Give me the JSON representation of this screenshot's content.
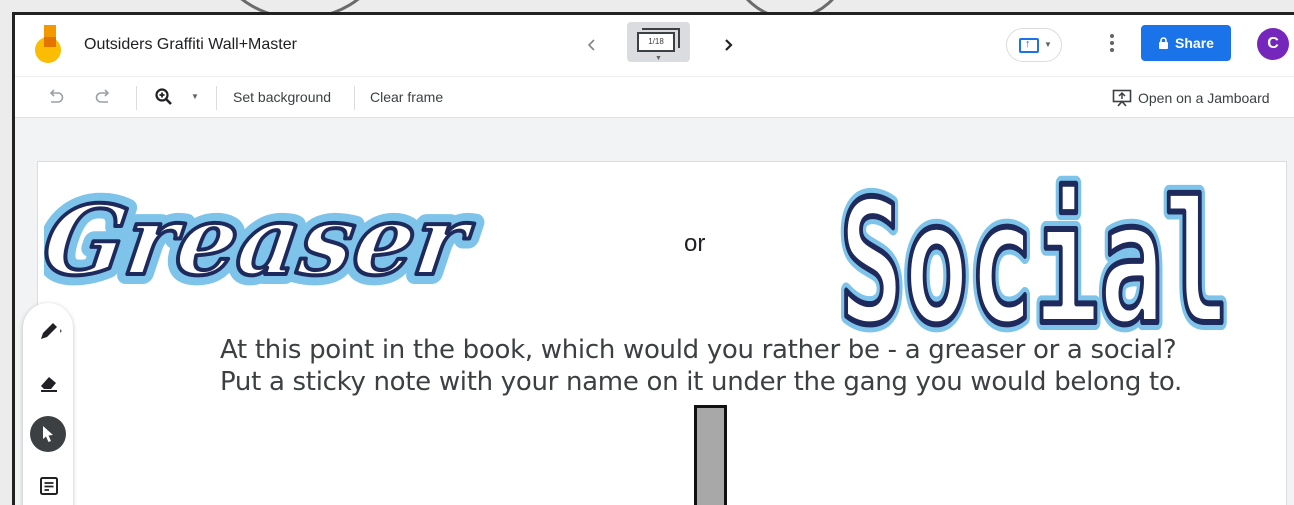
{
  "app": {
    "title": "Outsiders Graffiti Wall+Master",
    "frame_indicator": "1/18",
    "share_label": "Share",
    "avatar_initial": "C"
  },
  "toolbar": {
    "set_background_label": "Set background",
    "clear_frame_label": "Clear frame",
    "open_on_jamboard_label": "Open on a Jamboard"
  },
  "canvas": {
    "greaser_word": "Greaser",
    "or_text": "or",
    "social_word": "Social",
    "prompt_line_1": "At this point in the book, which would you rather be - a greaser or a social?",
    "prompt_line_2": "Put a sticky note with your name on it under the gang you would belong to."
  },
  "colors": {
    "accent": "#1a73e8",
    "avatar": "#7627bb",
    "graffiti_outline": "#1f2a5c",
    "graffiti_glow": "#7ec4ea"
  },
  "icons": {
    "undo": "undo-icon",
    "redo": "redo-icon",
    "zoom": "zoom-in-icon",
    "pen": "pen-icon",
    "eraser": "eraser-icon",
    "select": "cursor-icon",
    "sticky": "sticky-note-icon"
  }
}
